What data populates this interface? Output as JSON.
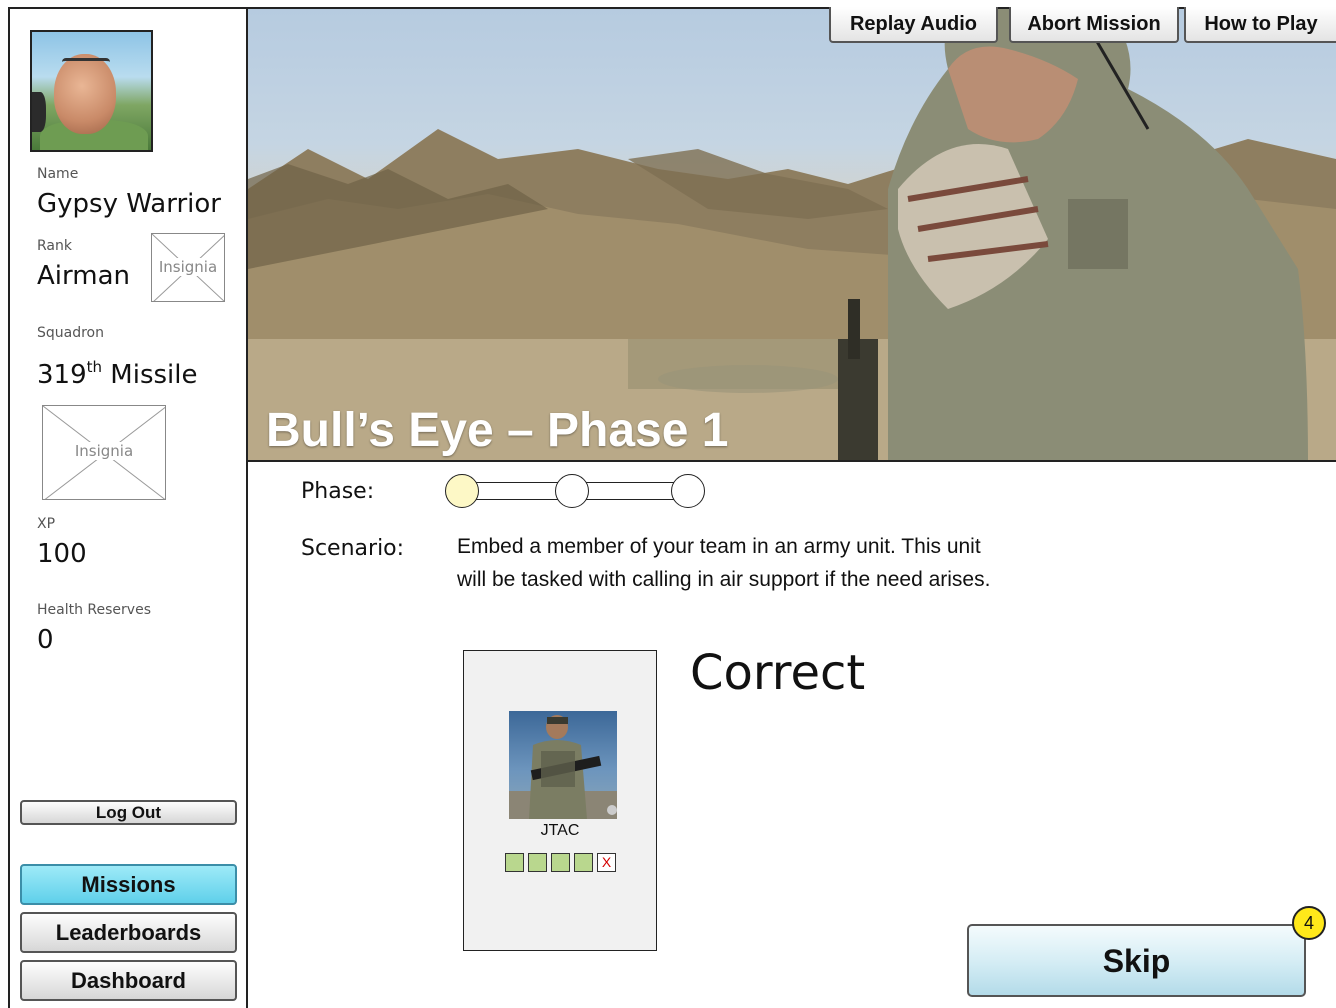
{
  "profile": {
    "name_label": "Name",
    "name": "Gypsy Warrior",
    "rank_label": "Rank",
    "rank": "Airman",
    "rank_insignia_label": "Insignia",
    "squadron_label": "Squadron",
    "squadron_number": "319",
    "squadron_suffix": "th",
    "squadron_name": " Missile",
    "squadron_insignia_label": "Insignia",
    "xp_label": "XP",
    "xp": "100",
    "health_label": "Health Reserves",
    "health": "0"
  },
  "sidebar": {
    "logout_label": "Log Out",
    "nav": [
      {
        "label": "Missions",
        "active": true
      },
      {
        "label": "Leaderboards",
        "active": false
      },
      {
        "label": "Dashboard",
        "active": false
      }
    ]
  },
  "header": {
    "buttons": [
      "Replay Audio",
      "Abort Mission",
      "How to Play"
    ],
    "mission_title": "Bull’s Eye – Phase 1"
  },
  "phase": {
    "label": "Phase:",
    "total": 3,
    "current": 1
  },
  "scenario": {
    "label": "Scenario:",
    "line1": "Embed a member of your team in an army unit. This unit",
    "line2": "will be tasked with calling in air support if the need arises."
  },
  "card": {
    "name": "JTAC",
    "ratings": [
      "pass",
      "pass",
      "pass",
      "pass",
      "fail"
    ],
    "fail_mark": "X"
  },
  "result": "Correct",
  "skip": {
    "label": "Skip",
    "badge": "4"
  },
  "colors": {
    "active_nav": "#5fd0ea",
    "phase_current": "#fdf8c6",
    "rating_pass": "#b9d78e",
    "badge": "#ffe81a"
  },
  "icons": {
    "placeholder": "image-placeholder-icon"
  }
}
